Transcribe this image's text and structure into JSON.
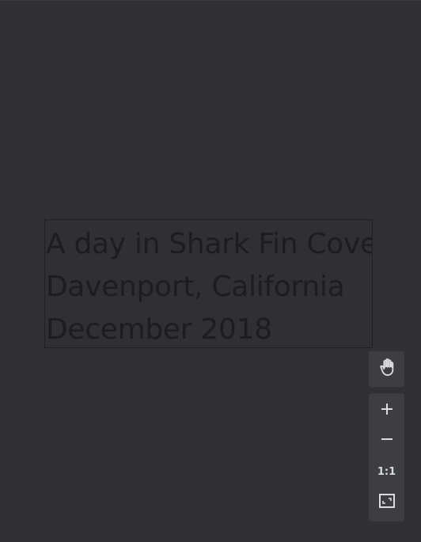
{
  "canvas": {
    "background": "#303134"
  },
  "text_object": {
    "lines": [
      "A day in Shark Fin Cove",
      "Davenport, California",
      "December 2018"
    ]
  },
  "controls": {
    "pan_icon": "hand-icon",
    "zoom_in_icon": "plus-icon",
    "zoom_out_icon": "minus-icon",
    "actual_size_label": "1:1",
    "fit_icon": "fit-to-screen-icon",
    "icon_color": "#dadce0",
    "button_background": "#3c3e42"
  }
}
